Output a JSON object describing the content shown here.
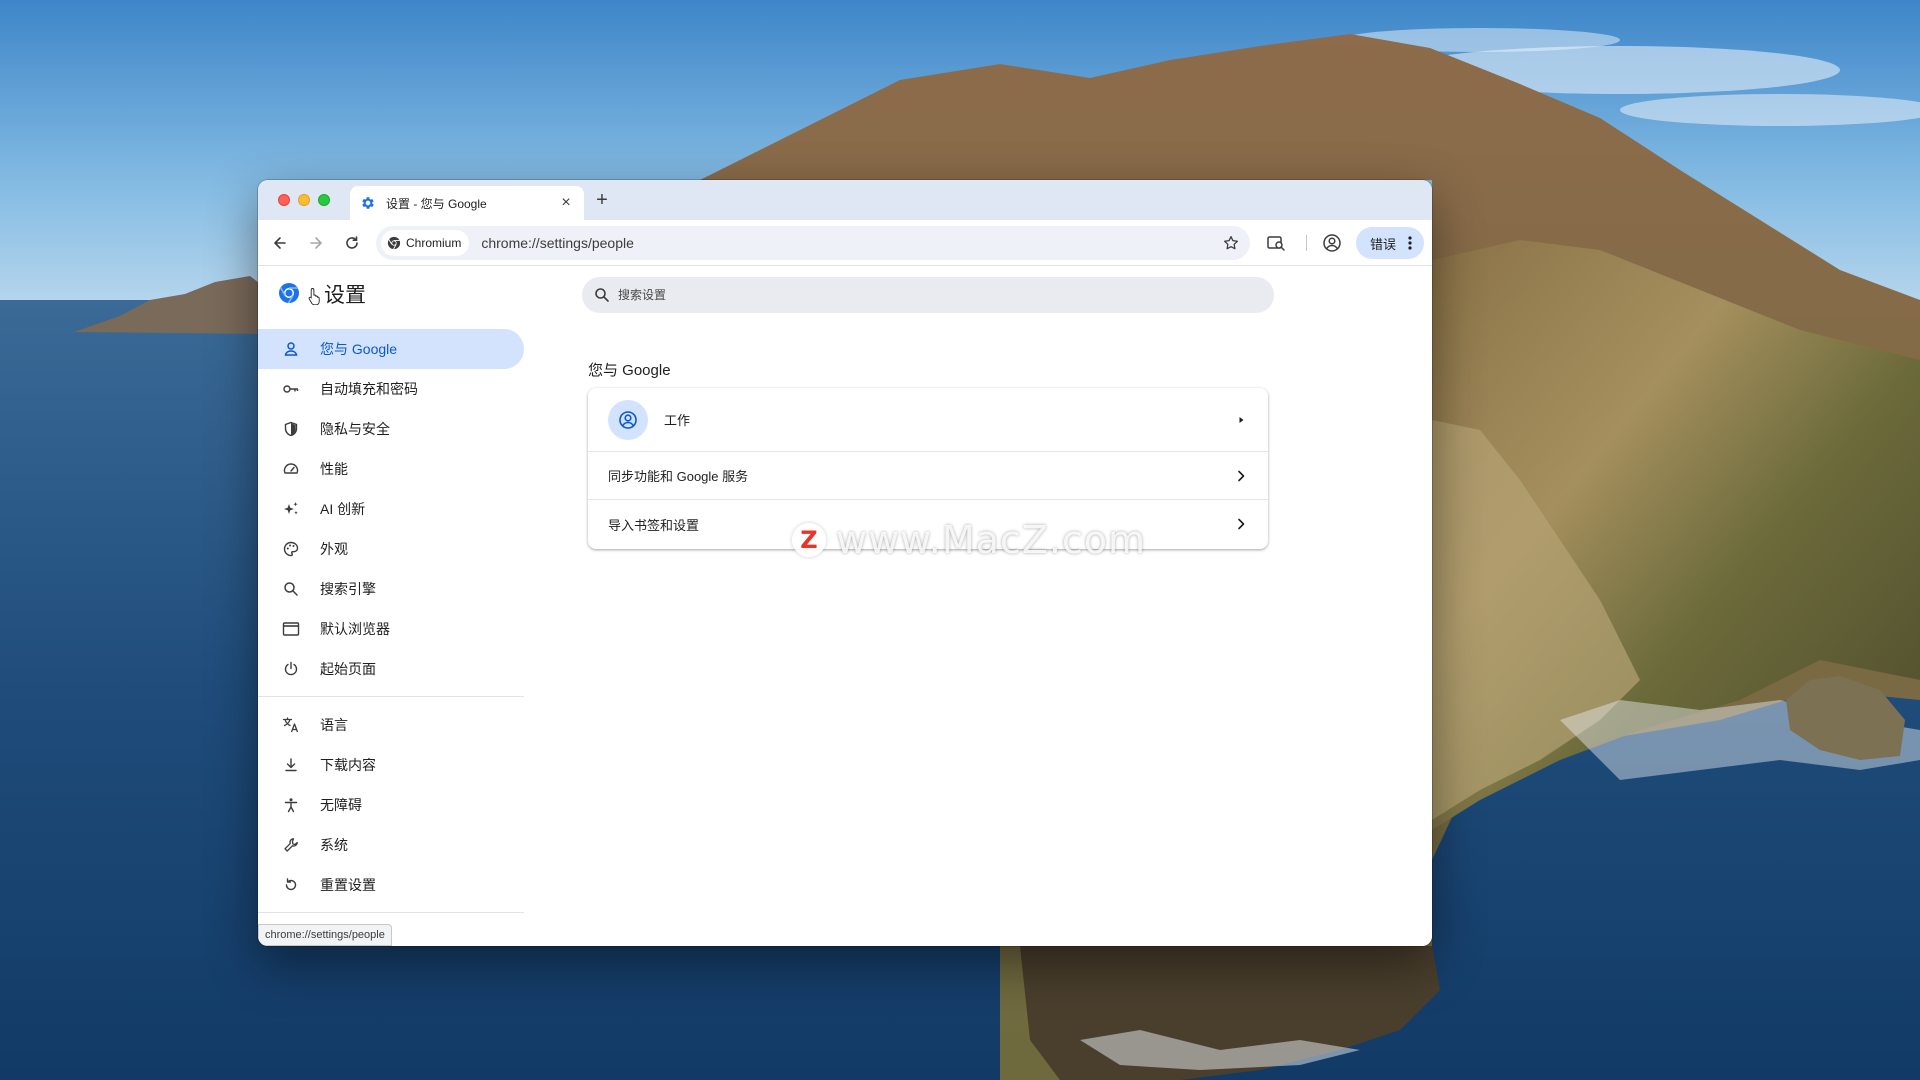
{
  "browser": {
    "tab": {
      "title": "设置 - 您与 Google",
      "icon": "gear-icon"
    },
    "new_tab_label": "+",
    "omnibox": {
      "site_chip": "Chromium",
      "url": "chrome://settings/people"
    },
    "profile_chip": "错误"
  },
  "settings": {
    "title": "设置",
    "search_placeholder": "搜索设置",
    "sidebar": {
      "primary": [
        {
          "label": "您与 Google",
          "icon": "person-icon",
          "active": true
        },
        {
          "label": "自动填充和密码",
          "icon": "key-icon"
        },
        {
          "label": "隐私与安全",
          "icon": "shield-icon"
        },
        {
          "label": "性能",
          "icon": "speedometer-icon"
        },
        {
          "label": "AI 创新",
          "icon": "sparkle-icon"
        },
        {
          "label": "外观",
          "icon": "palette-icon"
        },
        {
          "label": "搜索引擎",
          "icon": "search-icon"
        },
        {
          "label": "默认浏览器",
          "icon": "browser-window-icon"
        },
        {
          "label": "起始页面",
          "icon": "power-icon"
        }
      ],
      "secondary": [
        {
          "label": "语言",
          "icon": "translate-icon"
        },
        {
          "label": "下载内容",
          "icon": "download-icon"
        },
        {
          "label": "无障碍",
          "icon": "accessibility-icon"
        },
        {
          "label": "系统",
          "icon": "wrench-icon"
        },
        {
          "label": "重置设置",
          "icon": "reset-icon"
        }
      ]
    },
    "section_title": "您与 Google",
    "card": {
      "profile_name": "工作",
      "sync_label": "同步功能和 Google 服务",
      "import_label": "导入书签和设置"
    },
    "status_url": "chrome://settings/people"
  },
  "watermark": {
    "badge": "Z",
    "text": "www.MacZ.com"
  },
  "colors": {
    "accent": "#0b57d0",
    "active_nav_bg": "#d3e3fd",
    "titlebar_bg": "#dfe6f4"
  }
}
